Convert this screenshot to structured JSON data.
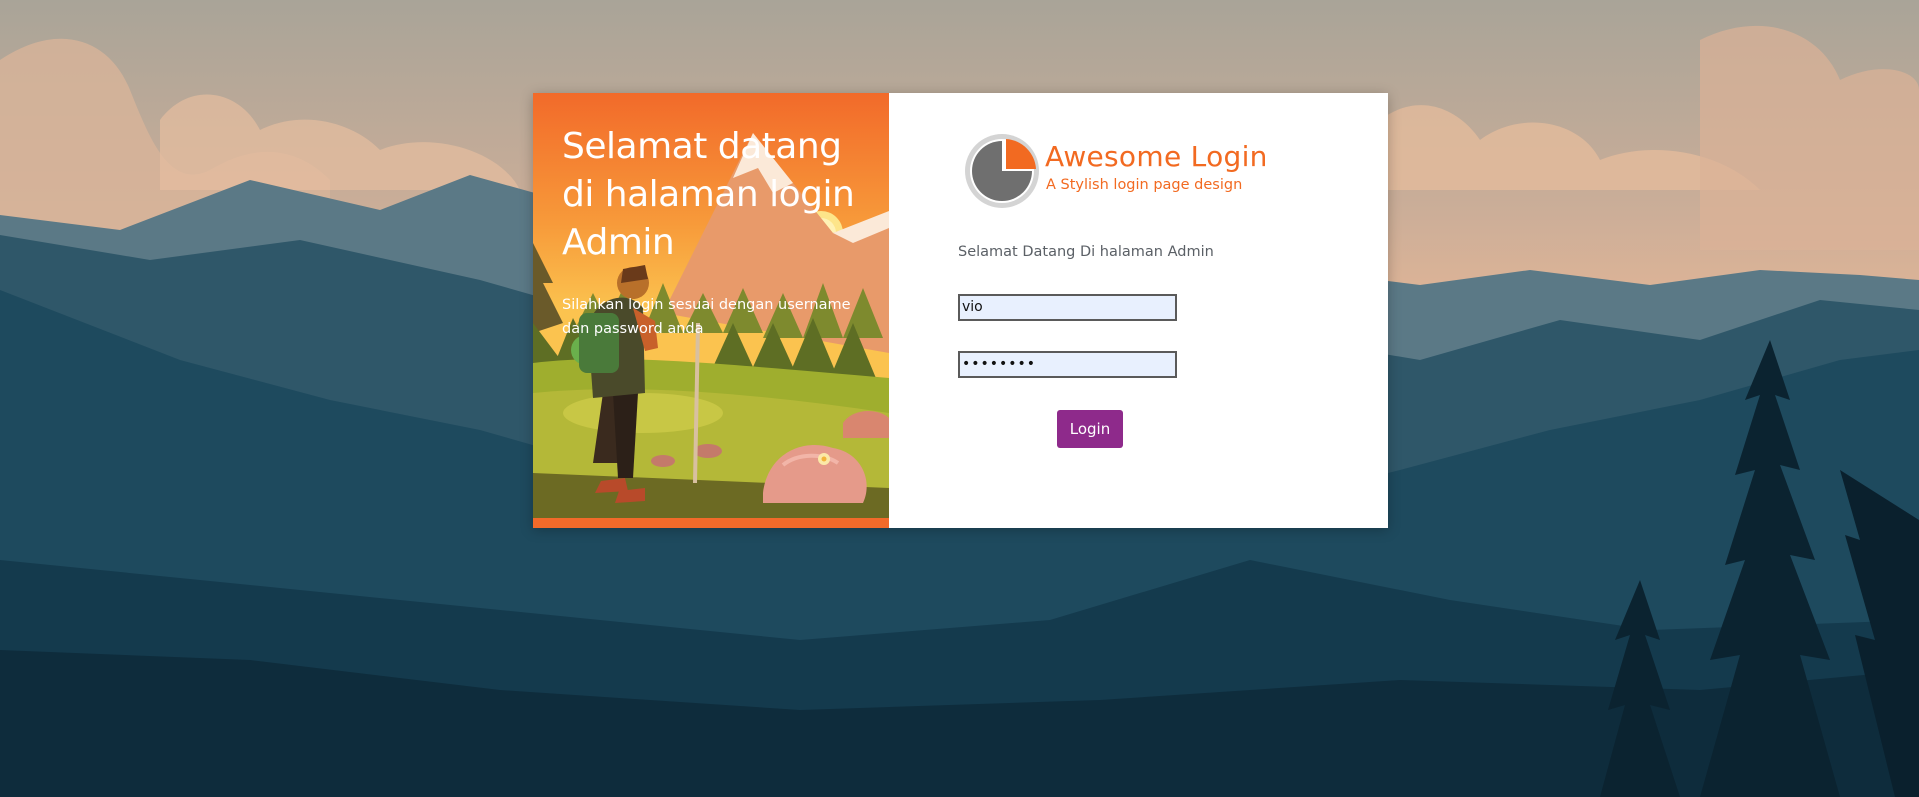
{
  "left": {
    "title": "Selamat datang di halaman login Admin",
    "subtitle": "Silahkan login sesuai dengan username dan password anda"
  },
  "logo": {
    "title": "Awesome Login",
    "subtitle": "A Stylish login page design"
  },
  "form": {
    "welcome_text": "Selamat Datang Di halaman Admin",
    "username_value": "vio",
    "password_value": "••••••••",
    "login_label": "Login"
  },
  "colors": {
    "accent_orange": "#f26a21",
    "button_purple": "#8e2a8b",
    "input_bg": "#e8f0fe"
  }
}
